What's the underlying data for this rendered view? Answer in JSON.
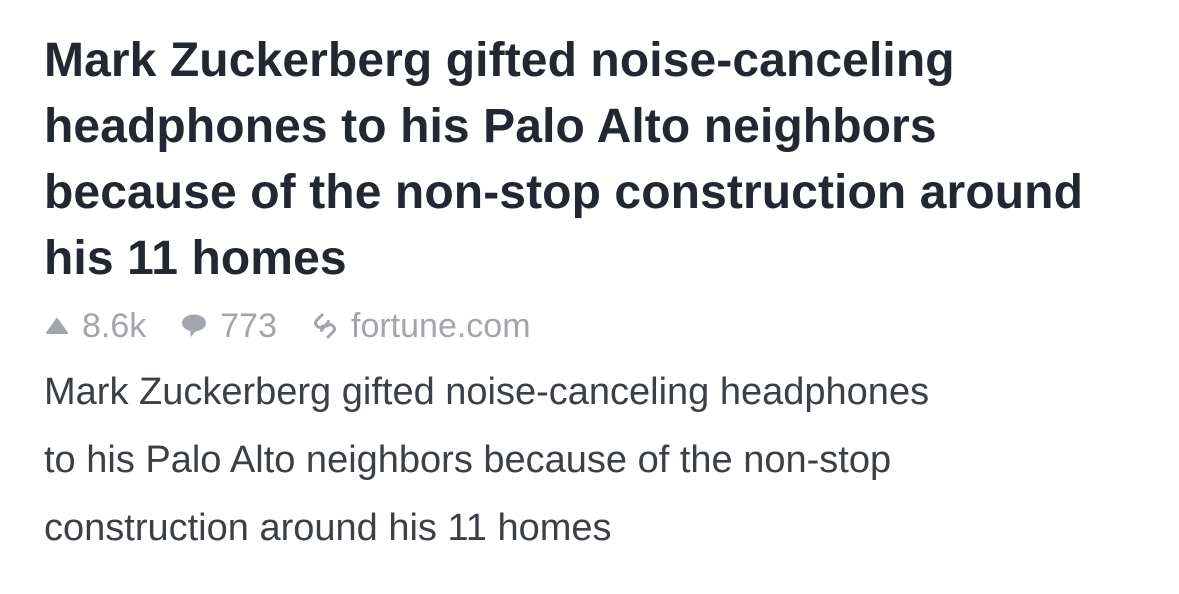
{
  "post": {
    "title": "Mark Zuckerberg gifted noise-canceling\nheadphones to his Palo Alto neighbors\nbecause of the non-stop construction around\nhis 11 homes",
    "meta": {
      "upvotes": "8.6k",
      "comments": "773",
      "domain": "fortune.com",
      "icons": {
        "upvote": "triangle-up-icon",
        "comments": "speech-bubble-icon",
        "link": "chain-link-icon"
      },
      "meta_color": "#a2a5ac"
    },
    "snippet": "Mark Zuckerberg gifted noise-canceling headphones\nto his Palo Alto neighbors because of the non-stop\nconstruction around his 11 homes"
  }
}
